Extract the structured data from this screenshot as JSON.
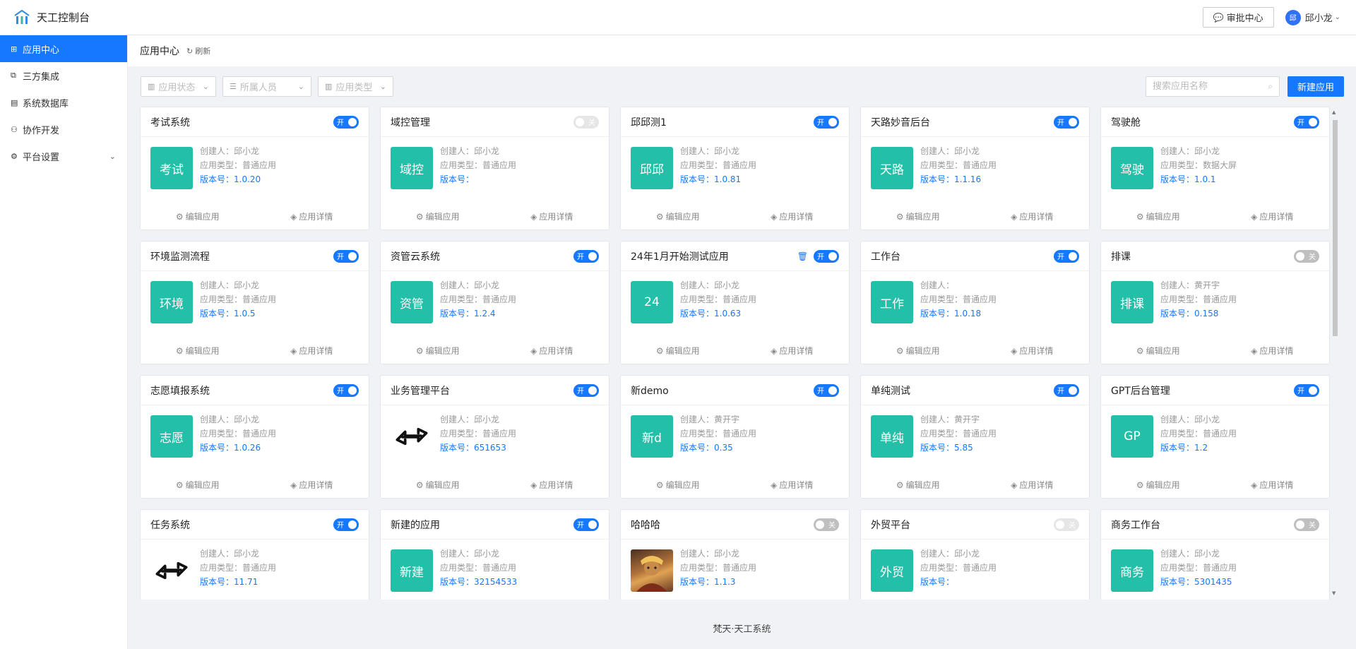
{
  "header": {
    "logo_text": "天工控制台",
    "approval_label": "审批中心",
    "user_avatar": "邱",
    "user_name": "邱小龙"
  },
  "sidebar": {
    "items": [
      {
        "label": "应用中心",
        "icon": "grid-icon",
        "active": true
      },
      {
        "label": "三方集成",
        "icon": "copy-icon"
      },
      {
        "label": "系统数据库",
        "icon": "database-icon"
      },
      {
        "label": "协作开发",
        "icon": "team-icon"
      },
      {
        "label": "平台设置",
        "icon": "gear-icon",
        "expandable": true
      }
    ]
  },
  "breadcrumb": {
    "title": "应用中心",
    "refresh_label": "刷新"
  },
  "filters": [
    {
      "placeholder": "应用状态",
      "icon": "bar-chart-icon"
    },
    {
      "placeholder": "所属人员",
      "icon": "list-icon"
    },
    {
      "placeholder": "应用类型",
      "icon": "bar-chart-icon"
    }
  ],
  "search": {
    "placeholder": "搜索应用名称"
  },
  "new_app_label": "新建应用",
  "labels": {
    "creator": "创建人：",
    "type": "应用类型：",
    "version": "版本号：",
    "edit": "编辑应用",
    "detail": "应用详情",
    "on": "开",
    "off": "关"
  },
  "colors": {
    "primary": "#1677ff",
    "icon_bg": "#24bfa9"
  },
  "apps": [
    {
      "name": "考试系统",
      "icon_text": "考试",
      "creator": "邱小龙",
      "type": "普通应用",
      "version": "1.0.20",
      "status": "on"
    },
    {
      "name": "域控管理",
      "icon_text": "域控",
      "creator": "邱小龙",
      "type": "普通应用",
      "version": "",
      "status": "disabled"
    },
    {
      "name": "邱邱测1",
      "icon_text": "邱邱",
      "creator": "邱小龙",
      "type": "普通应用",
      "version": "1.0.81",
      "status": "on"
    },
    {
      "name": "天路妙音后台",
      "icon_text": "天路",
      "creator": "邱小龙",
      "type": "普通应用",
      "version": "1.1.16",
      "status": "on"
    },
    {
      "name": "驾驶舱",
      "icon_text": "驾驶",
      "creator": "邱小龙",
      "type": "数据大屏",
      "version": "1.0.1",
      "status": "on"
    },
    {
      "name": "环境监测流程",
      "icon_text": "环境",
      "creator": "邱小龙",
      "type": "普通应用",
      "version": "1.0.5",
      "status": "on"
    },
    {
      "name": "资管云系统",
      "icon_text": "资管",
      "creator": "邱小龙",
      "type": "普通应用",
      "version": "1.2.4",
      "status": "on"
    },
    {
      "name": "24年1月开始测试应用",
      "icon_text": "24",
      "creator": "邱小龙",
      "type": "普通应用",
      "version": "1.0.63",
      "status": "on",
      "trash": true
    },
    {
      "name": "工作台",
      "icon_text": "工作",
      "creator": "",
      "type": "普通应用",
      "version": "1.0.18",
      "status": "on"
    },
    {
      "name": "排课",
      "icon_text": "排课",
      "creator": "黄开宇",
      "type": "普通应用",
      "version": "0.158",
      "status": "off"
    },
    {
      "name": "志愿填报系统",
      "icon_text": "志愿",
      "creator": "邱小龙",
      "type": "普通应用",
      "version": "1.0.26",
      "status": "on"
    },
    {
      "name": "业务管理平台",
      "icon_text": "",
      "icon_kind": "arrows",
      "creator": "邱小龙",
      "type": "普通应用",
      "version": "651653",
      "status": "on"
    },
    {
      "name": "新demo",
      "icon_text": "新d",
      "creator": "黄开宇",
      "type": "普通应用",
      "version": "0.35",
      "status": "on"
    },
    {
      "name": "单纯测试",
      "icon_text": "单纯",
      "creator": "黄开宇",
      "type": "普通应用",
      "version": "5.85",
      "status": "on"
    },
    {
      "name": "GPT后台管理",
      "icon_text": "GP",
      "creator": "邱小龙",
      "type": "普通应用",
      "version": "1.2",
      "status": "on"
    },
    {
      "name": "任务系统",
      "icon_text": "",
      "icon_kind": "arrows",
      "creator": "邱小龙",
      "type": "普通应用",
      "version": "11.71",
      "status": "on"
    },
    {
      "name": "新建的应用",
      "icon_text": "新建",
      "creator": "邱小龙",
      "type": "普通应用",
      "version": "32154533",
      "status": "on"
    },
    {
      "name": "哈哈哈",
      "icon_text": "",
      "icon_kind": "photo",
      "creator": "邱小龙",
      "type": "普通应用",
      "version": "1.1.3",
      "status": "off"
    },
    {
      "name": "外贸平台",
      "icon_text": "外贸",
      "creator": "邱小龙",
      "type": "普通应用",
      "version": "",
      "status": "disabled"
    },
    {
      "name": "商务工作台",
      "icon_text": "商务",
      "creator": "邱小龙",
      "type": "普通应用",
      "version": "5301435",
      "status": "off"
    }
  ],
  "footer_text": "梵天·天工系统"
}
